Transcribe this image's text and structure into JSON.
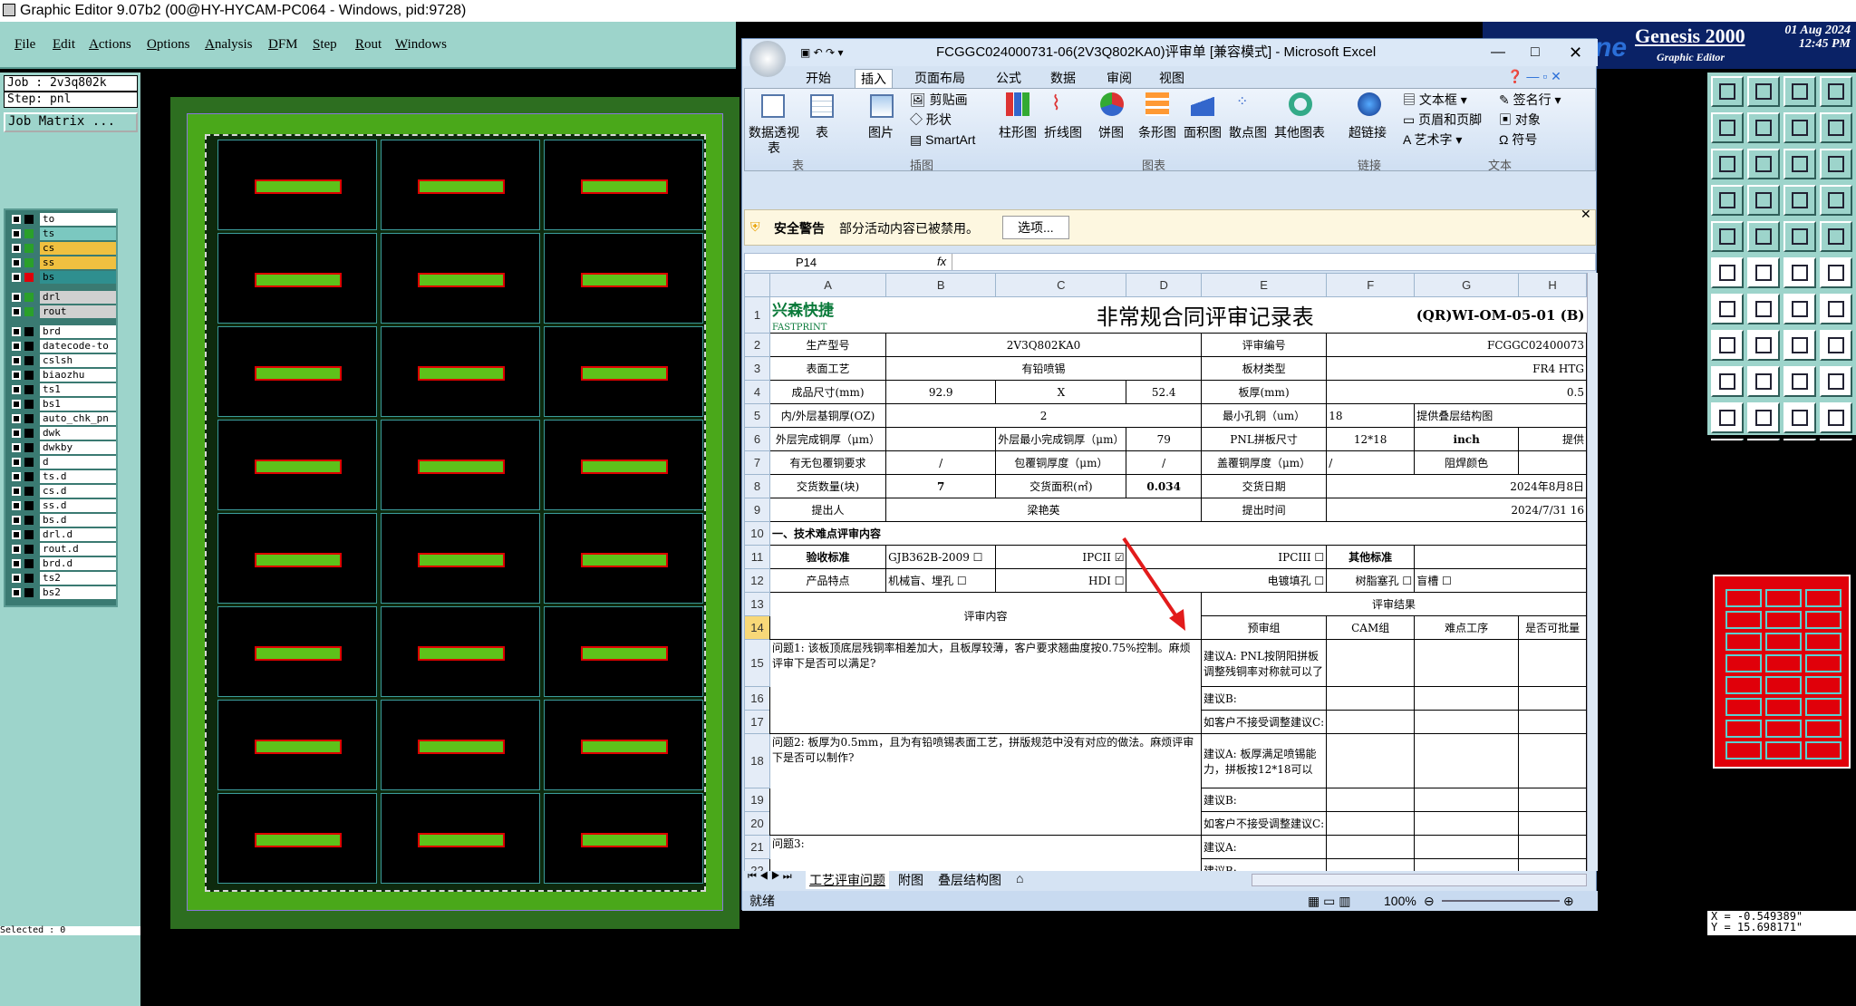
{
  "app_title": "Graphic Editor 9.07b2 (00@HY-HYCAM-PC064 - Windows, pid:9728)",
  "menu": [
    "File",
    "Edit",
    "Actions",
    "Options",
    "Analysis",
    "DFM",
    "Step",
    "Rout",
    "Windows"
  ],
  "genesis": {
    "title": "Genesis 2000",
    "subtitle": "Graphic Editor",
    "date": "01 Aug 2024",
    "time": "12:45 PM",
    "badge": "ne"
  },
  "job": {
    "job_label": "Job : 2v3q802k",
    "step_label": "Step: pnl",
    "matrix_button": "Job Matrix ..."
  },
  "layers": [
    {
      "name": "to",
      "color": "#ffffff"
    },
    {
      "name": "ts",
      "color": "#7bc8c0"
    },
    {
      "name": "cs",
      "color": "#f0c040"
    },
    {
      "name": "ss",
      "color": "#f0c040"
    },
    {
      "name": "bs",
      "color": "#f0c040",
      "active": true
    },
    {
      "name": "drl",
      "color": "#d0d0d0"
    },
    {
      "name": "rout",
      "color": "#d0d0d0"
    },
    {
      "name": "brd",
      "color": "#ffffff"
    },
    {
      "name": "datecode-to",
      "color": "#ffffff"
    },
    {
      "name": "cslsh",
      "color": "#ffffff"
    },
    {
      "name": "biaozhu",
      "color": "#ffffff"
    },
    {
      "name": "ts1",
      "color": "#ffffff"
    },
    {
      "name": "bs1",
      "color": "#ffffff"
    },
    {
      "name": "auto_chk_pn",
      "color": "#ffffff"
    },
    {
      "name": "dwk",
      "color": "#ffffff"
    },
    {
      "name": "dwkby",
      "color": "#ffffff"
    },
    {
      "name": "d",
      "color": "#ffffff"
    },
    {
      "name": "ts.d",
      "color": "#ffffff"
    },
    {
      "name": "cs.d",
      "color": "#ffffff"
    },
    {
      "name": "ss.d",
      "color": "#ffffff"
    },
    {
      "name": "bs.d",
      "color": "#ffffff"
    },
    {
      "name": "drl.d",
      "color": "#ffffff"
    },
    {
      "name": "rout.d",
      "color": "#ffffff"
    },
    {
      "name": "brd.d",
      "color": "#ffffff"
    },
    {
      "name": "ts2",
      "color": "#ffffff"
    },
    {
      "name": "bs2",
      "color": "#ffffff"
    }
  ],
  "selected_label": "Selected : 0",
  "coords": {
    "x": "X = -0.549389\"",
    "y": "Y = 15.698171\""
  },
  "excel": {
    "title": "FCGGC024000731-06(2V3Q802KA0)评审单  [兼容模式] - Microsoft Excel",
    "tabs": [
      "开始",
      "插入",
      "页面布局",
      "公式",
      "数据",
      "审阅",
      "视图"
    ],
    "active_tab": "插入",
    "ribbon": {
      "pivot": "数据透视表",
      "table": "表",
      "picture": "图片",
      "clipart": "剪贴画",
      "shapes": "形状",
      "smartart": "SmartArt",
      "charts": [
        "柱形图",
        "折线图",
        "饼图",
        "条形图",
        "面积图",
        "散点图",
        "其他图表"
      ],
      "hyperlink": "超链接",
      "textbox": "文本框",
      "headerfooter": "页眉和页脚",
      "wordart": "艺术字",
      "signature": "签名行",
      "object": "对象",
      "symbol": "符号",
      "groups": [
        "表",
        "插图",
        "图表",
        "链接",
        "文本"
      ]
    },
    "security": {
      "label": "安全警告",
      "message": "部分活动内容已被禁用。",
      "button": "选项..."
    },
    "namebox": "P14",
    "fx": "fx",
    "columns": [
      "A",
      "B",
      "C",
      "D",
      "E",
      "F",
      "G",
      "H"
    ],
    "rows": {
      "r1": {
        "logo_cn": "兴森快捷",
        "logo_en": "FASTPRINT",
        "title": "非常规合同评审记录表",
        "code": "(QR)WI-OM-05-01 (B)"
      },
      "r2": [
        "生产型号",
        "2V3Q802KA0",
        "评审编号",
        "FCGGC02400073"
      ],
      "r3": [
        "表面工艺",
        "有铅喷锡",
        "板材类型",
        "FR4 HTG"
      ],
      "r4": [
        "成品尺寸(mm)",
        "92.9",
        "X",
        "52.4",
        "板厚(mm)",
        "0.5"
      ],
      "r5": [
        "内/外层基铜厚(OZ)",
        "2",
        "最小孔铜（um）",
        "18",
        "提供叠层结构图"
      ],
      "r6": [
        "外层完成铜厚（μm）",
        "外层最小完成铜厚（μm）",
        "79",
        "PNL拼板尺寸",
        "12*18",
        "inch",
        "提供"
      ],
      "r7": [
        "有无包覆铜要求",
        "/",
        "包覆铜厚度（μm）",
        "/",
        "盖覆铜厚度（μm）",
        "/",
        "阻焊颜色"
      ],
      "r8": [
        "交货数量(块)",
        "7",
        "交货面积(㎡)",
        "0.034",
        "交货日期",
        "2024年8月8日"
      ],
      "r9": [
        "提出人",
        "梁艳英",
        "提出时间",
        "2024/7/31 16"
      ],
      "r10": "一、技术难点评审内容",
      "r11": [
        "验收标准",
        "GJB362B-2009",
        "IPCII",
        "IPCIII",
        "其他标准"
      ],
      "r12": [
        "产品特点",
        "机械盲、埋孔",
        "HDI",
        "电镀填孔",
        "树脂塞孔",
        "盲槽"
      ],
      "r13": [
        "评审内容",
        "评审结果"
      ],
      "r14": [
        "预审组",
        "CAM组",
        "难点工序",
        "是否可批量"
      ],
      "q1": "问题1: 该板顶底层残铜率相差加大，且板厚较薄，客户要求翘曲度按0.75%控制。麻烦评审下是否可以满足?",
      "q1a": "建议A: PNL按阴阳拼板调整残铜率对称就可以了",
      "q1b": "建议B:",
      "q1c": "如客户不接受调整建议C:",
      "q2": "问题2: 板厚为0.5mm，且为有铅喷锡表面工艺，拼版规范中没有对应的做法。麻烦评审下是否可以制作?",
      "q2a": "建议A: 板厚满足喷锡能力，拼板按12*18可以",
      "q2b": "建议B:",
      "q2c": "如客户不接受调整建议C:",
      "q3": "问题3:",
      "q3a": "建议A:",
      "q3b": "建议B:"
    },
    "sheets": [
      "工艺评审问题",
      "附图",
      "叠层结构图"
    ],
    "status": "就绪",
    "zoom": "100%"
  }
}
